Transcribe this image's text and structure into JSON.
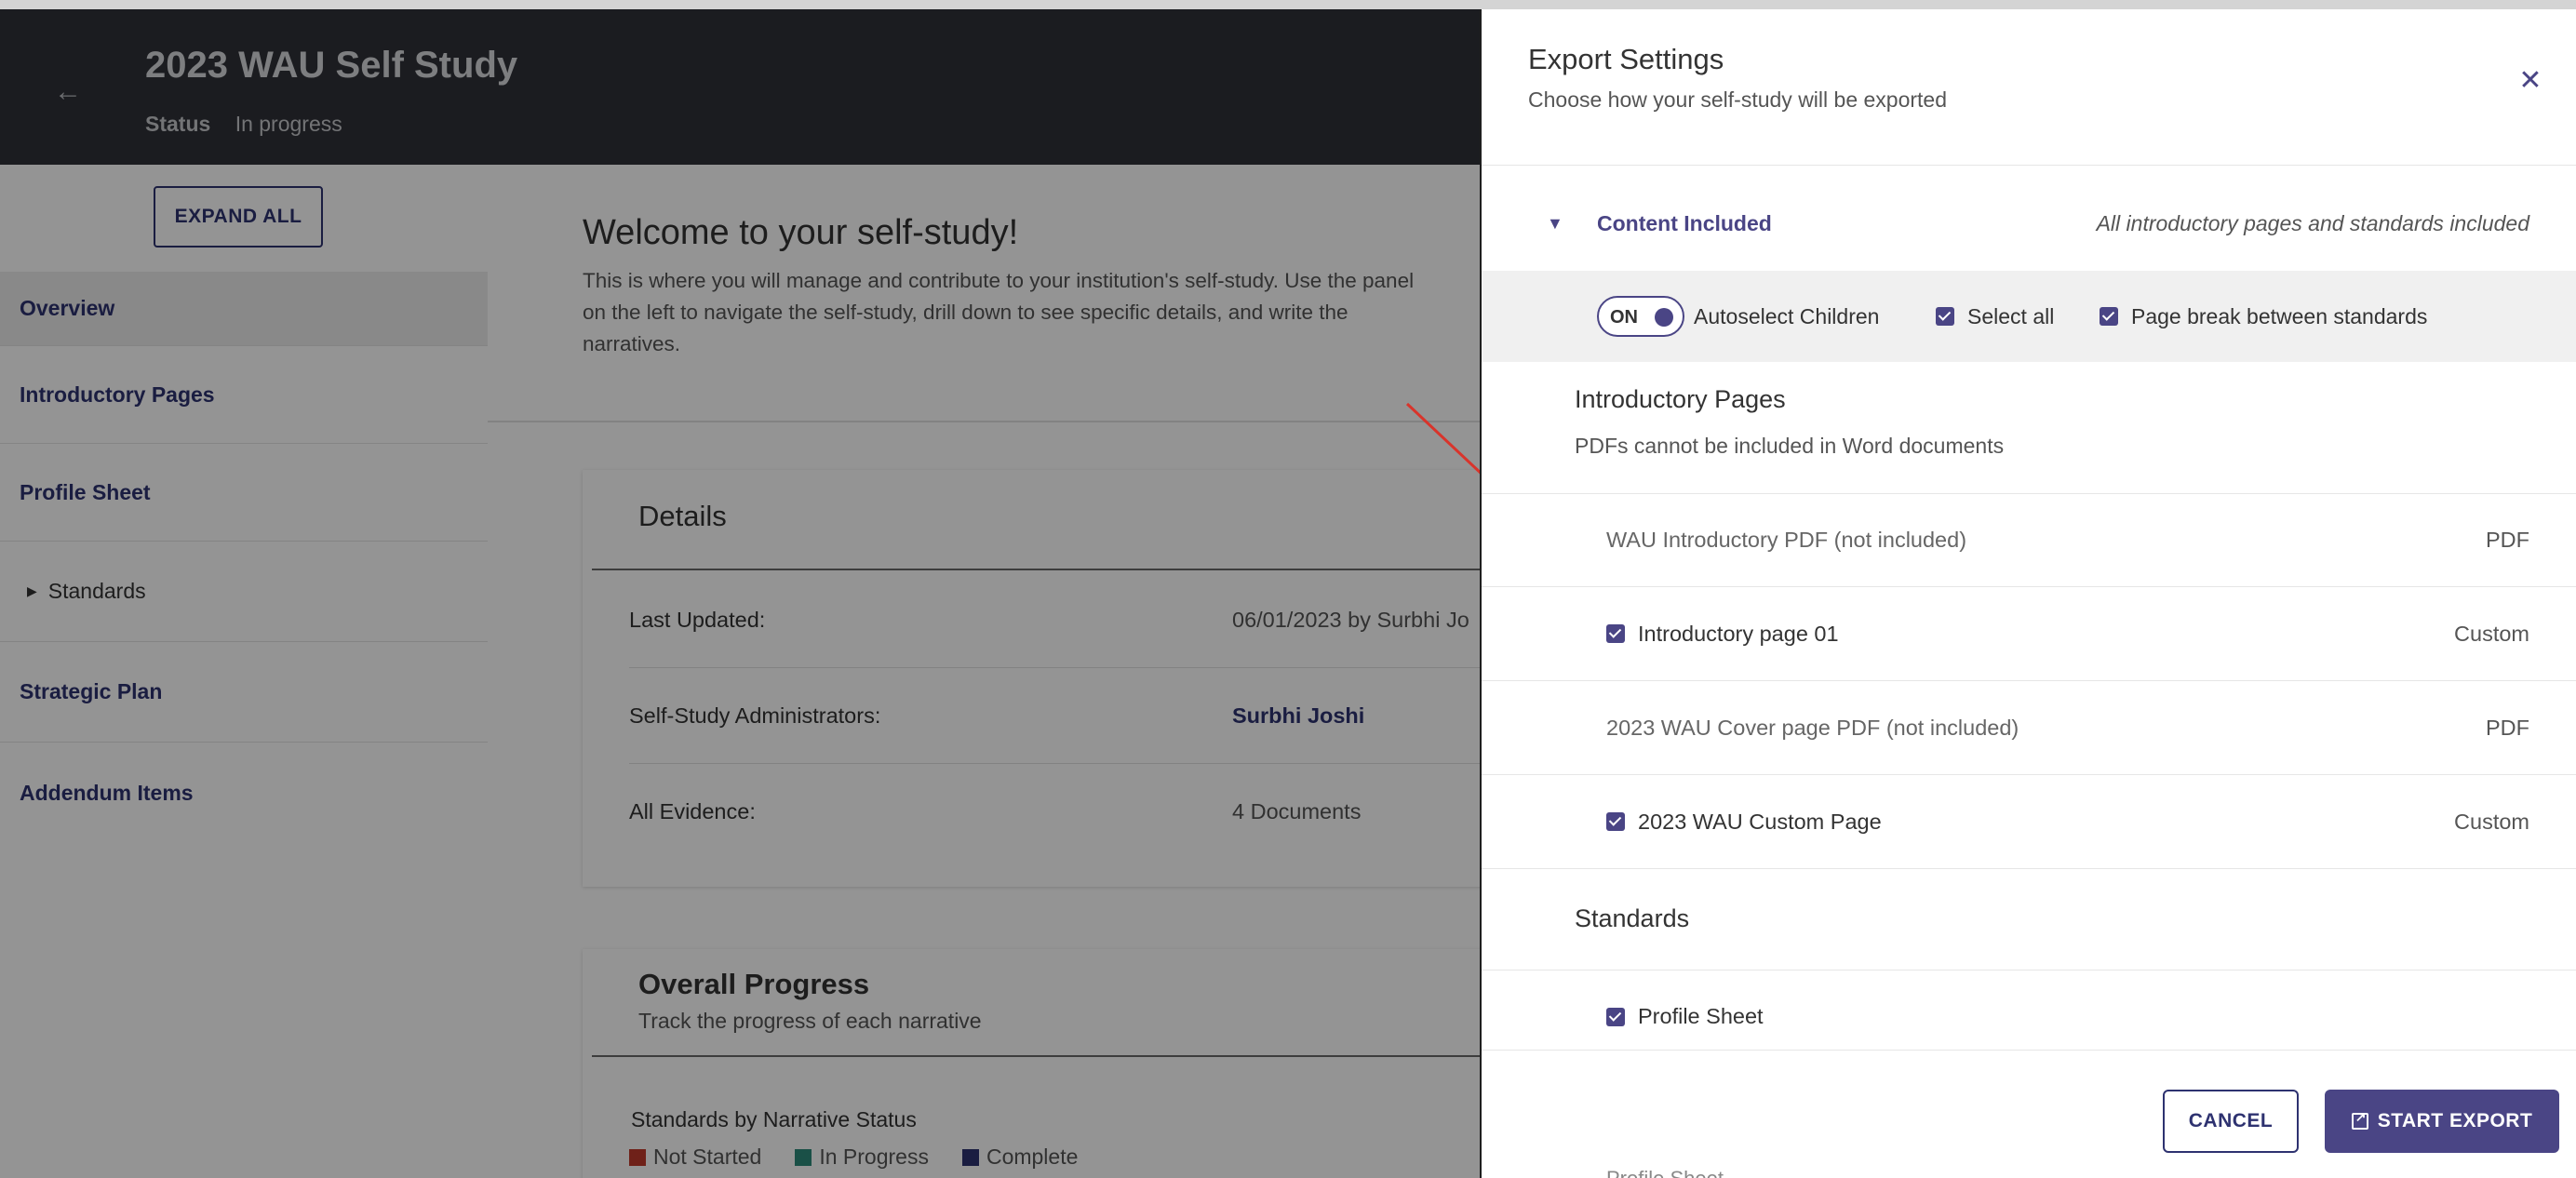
{
  "header": {
    "title": "2023 WAU Self Study",
    "status_label": "Status",
    "status_value": "In progress"
  },
  "sidebar": {
    "expand_all": "EXPAND ALL",
    "items": [
      {
        "label": "Overview"
      },
      {
        "label": "Introductory Pages"
      },
      {
        "label": "Profile Sheet"
      },
      {
        "label": "Standards"
      },
      {
        "label": "Strategic Plan"
      },
      {
        "label": "Addendum Items"
      }
    ]
  },
  "main": {
    "welcome_title": "Welcome to your self-study!",
    "welcome_text": "This is where you will manage and contribute to your institution's self-study. Use the panel on the left to navigate the self-study, drill down to see specific details, and write the narratives.",
    "details": {
      "title": "Details",
      "rows": [
        {
          "label": "Last Updated:",
          "value": "06/01/2023 by Surbhi Jo"
        },
        {
          "label": "Self-Study Administrators:",
          "value": "Surbhi Joshi"
        },
        {
          "label": "All Evidence:",
          "value": "4 Documents"
        }
      ]
    },
    "progress": {
      "title": "Overall Progress",
      "subtitle": "Track the progress of each narrative",
      "chart_title": "Standards by Narrative Status",
      "legend": [
        {
          "label": "Not Started",
          "color": "#c0392b"
        },
        {
          "label": "In Progress",
          "color": "#2e8b7a"
        },
        {
          "label": "Complete",
          "color": "#2e3270"
        }
      ]
    }
  },
  "drawer": {
    "title": "Export Settings",
    "subtitle": "Choose how your self-study will be exported",
    "section": {
      "name": "Content Included",
      "summary": "All introductory pages and standards included"
    },
    "options": {
      "toggle": "ON",
      "autoselect": "Autoselect Children",
      "select_all": "Select all",
      "page_break": "Page break between standards"
    },
    "intro_group": {
      "title": "Introductory Pages",
      "note": "PDFs cannot be included in Word documents",
      "items": [
        {
          "label": "WAU Introductory PDF (not included)",
          "type": "PDF"
        },
        {
          "label": "Introductory page 01",
          "type": "Custom"
        },
        {
          "label": "2023 WAU Cover page PDF (not included)",
          "type": "PDF"
        },
        {
          "label": "2023 WAU Custom Page",
          "type": "Custom"
        }
      ]
    },
    "standards_group": {
      "title": "Standards",
      "items": [
        {
          "label": "Profile Sheet"
        }
      ]
    },
    "peek_text": "Profile Sheet",
    "cancel": "CANCEL",
    "start_export": "START EXPORT"
  },
  "colors": {
    "accent": "#4a4585",
    "header_bg": "#2f3138",
    "annotation": "#d9342b"
  }
}
